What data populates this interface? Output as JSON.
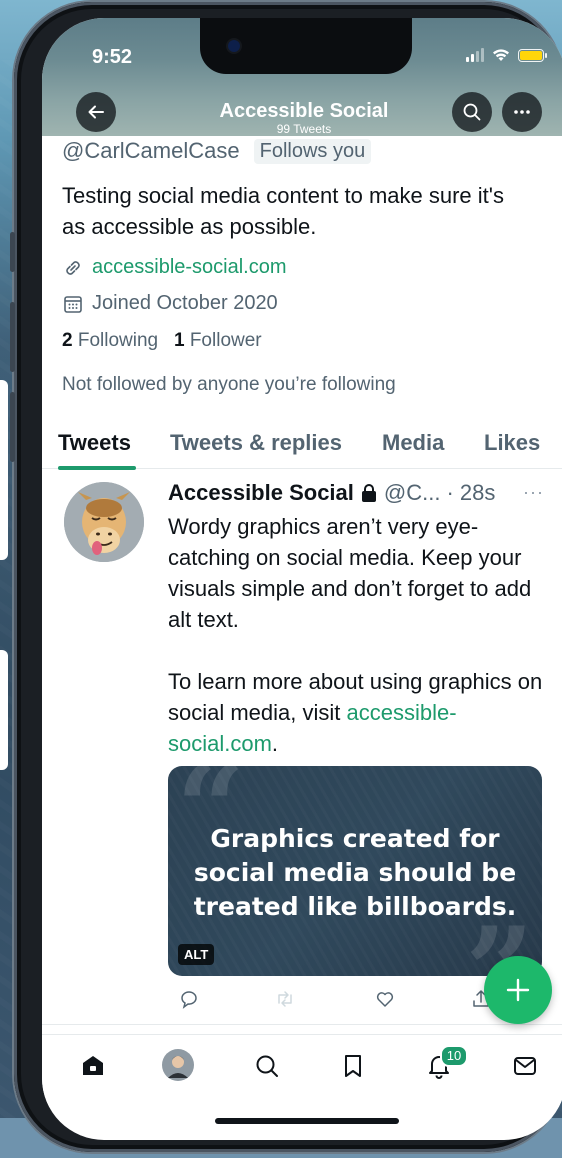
{
  "status_bar": {
    "time": "9:52"
  },
  "header": {
    "title": "Accessible Social",
    "subtitle": "99 Tweets"
  },
  "profile": {
    "handle": "@CarlCamelCase",
    "follows_badge": "Follows you",
    "bio": "Testing social media content to make sure it's as accessible as possible.",
    "website": "accessible-social.com",
    "joined": "Joined October 2020",
    "following_count": "2",
    "following_label": "Following",
    "followers_count": "1",
    "followers_label": "Follower",
    "not_followed": "Not followed by anyone you’re following"
  },
  "tabs": [
    {
      "label": "Tweets",
      "active": true
    },
    {
      "label": "Tweets & replies"
    },
    {
      "label": "Media"
    },
    {
      "label": "Likes"
    }
  ],
  "tweet": {
    "name": "Accessible Social",
    "handle": "@C...",
    "time": "· 28s",
    "more": "···",
    "paragraph1": "Wordy graphics aren’t very eye-catching on social media. Keep your visuals simple and don’t forget to add alt text.",
    "paragraph2_prefix": "To learn more about using graphics on social media, visit ",
    "paragraph2_link": "accessible-social.com",
    "paragraph2_suffix": ".",
    "media_text": "Graphics created for social media should be treated like billboards.",
    "alt_badge": "ALT"
  },
  "bottom_nav": {
    "notifications_count": "10"
  },
  "colors": {
    "accent": "#1d9a6c",
    "fab": "#1db86b",
    "text": "#0f1419",
    "secondary": "#536471"
  },
  "icons": [
    "back-arrow-icon",
    "search-icon",
    "more-icon",
    "link-icon",
    "calendar-icon",
    "lock-icon",
    "reply-icon",
    "retweet-icon",
    "like-icon",
    "share-icon",
    "compose-plus-icon",
    "home-icon",
    "profile-avatar",
    "search-nav-icon",
    "bookmark-icon",
    "notifications-icon",
    "messages-icon"
  ]
}
